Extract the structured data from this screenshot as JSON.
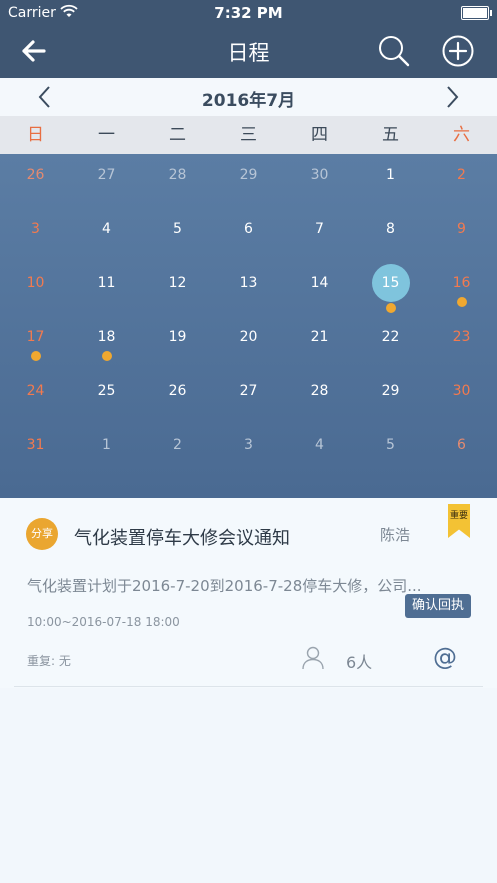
{
  "status_bar": {
    "carrier": "Carrier",
    "time": "7:32 PM"
  },
  "nav": {
    "title": "日程",
    "back_icon": "arrow-left-icon",
    "search_icon": "search-icon",
    "add_icon": "plus-circle-icon"
  },
  "calendar": {
    "month_label": "2016年7月",
    "weekdays": [
      "日",
      "一",
      "二",
      "三",
      "四",
      "五",
      "六"
    ],
    "weeks": [
      [
        {
          "d": "26",
          "o": true
        },
        {
          "d": "27",
          "o": true
        },
        {
          "d": "28",
          "o": true
        },
        {
          "d": "29",
          "o": true
        },
        {
          "d": "30",
          "o": true
        },
        {
          "d": "1"
        },
        {
          "d": "2"
        }
      ],
      [
        {
          "d": "3"
        },
        {
          "d": "4"
        },
        {
          "d": "5"
        },
        {
          "d": "6"
        },
        {
          "d": "7"
        },
        {
          "d": "8"
        },
        {
          "d": "9"
        }
      ],
      [
        {
          "d": "10"
        },
        {
          "d": "11"
        },
        {
          "d": "12"
        },
        {
          "d": "13"
        },
        {
          "d": "14"
        },
        {
          "d": "15",
          "today": true,
          "dot": true
        },
        {
          "d": "16",
          "dot": true
        }
      ],
      [
        {
          "d": "17",
          "dot": true
        },
        {
          "d": "18",
          "dot": true
        },
        {
          "d": "19"
        },
        {
          "d": "20"
        },
        {
          "d": "21"
        },
        {
          "d": "22"
        },
        {
          "d": "23"
        }
      ],
      [
        {
          "d": "24"
        },
        {
          "d": "25"
        },
        {
          "d": "26"
        },
        {
          "d": "27"
        },
        {
          "d": "28"
        },
        {
          "d": "29"
        },
        {
          "d": "30"
        }
      ],
      [
        {
          "d": "31"
        },
        {
          "d": "1",
          "o": true
        },
        {
          "d": "2",
          "o": true
        },
        {
          "d": "3",
          "o": true
        },
        {
          "d": "4",
          "o": true
        },
        {
          "d": "5",
          "o": true
        },
        {
          "d": "6",
          "o": true
        }
      ]
    ]
  },
  "event": {
    "tag": "分享",
    "title": "气化装置停车大修会议通知",
    "person": "陈浩",
    "badge": "重要",
    "description": "气化装置计划于2016-7-20到2016-7-28停车大修，公司...",
    "confirm_label": "确认回执",
    "time": "10:00~2016-07-18 18:00",
    "repeat": "重复: 无",
    "participants": "6人",
    "mention_symbol": "@"
  },
  "colors": {
    "header": "#3f5672",
    "grid": "#5b7da4",
    "weekend": "#e86e42",
    "today": "#7fc4dd",
    "event_dot": "#f0a830",
    "confirm": "#4f6e93",
    "ribbon": "#f3c234"
  }
}
